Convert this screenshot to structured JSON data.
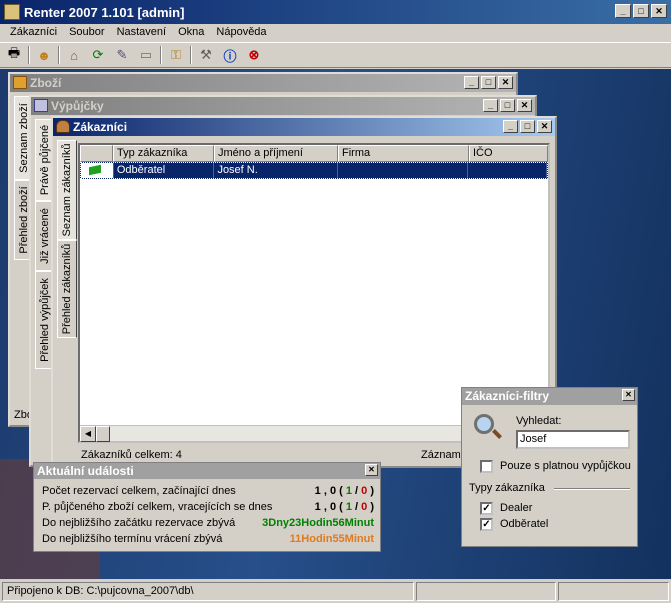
{
  "app": {
    "title": "Renter 2007 1.101 [admin]"
  },
  "menu": {
    "items": [
      "Zákazníci",
      "Soubor",
      "Nastavení",
      "Okna",
      "Nápověda"
    ]
  },
  "toolbar": {
    "icons": [
      "print-icon",
      "user-icon",
      "home-icon",
      "refresh-icon",
      "tools-icon",
      "window-icon",
      "lock-icon",
      "wrench-icon",
      "info-icon",
      "close-icon"
    ]
  },
  "windows": {
    "zbozi": {
      "title": "Zboží",
      "tabs": [
        "Seznam zboží",
        "Přehled zboží"
      ],
      "cut_label": "Zbo"
    },
    "vypujcky": {
      "title": "Výpůjčky",
      "tabs": [
        "Právě půjčené",
        "Již vrácené",
        "Přehled výpůjček"
      ]
    },
    "zakaznici": {
      "title": "Zákazníci",
      "tabs": [
        "Seznam zákazníků",
        "Přehled zákazníků"
      ],
      "columns": [
        "",
        "Typ zákazníka",
        "Jméno a příjmení",
        "Firma",
        "IČO"
      ],
      "rows": [
        {
          "type": "Odběratel",
          "name": "Josef N.",
          "company": "",
          "ico": ""
        }
      ],
      "footer_count": "Zákazníků celkem: 4",
      "footer_right": "Záznam"
    }
  },
  "events": {
    "title": "Aktuální události",
    "rows": [
      {
        "label": "Počet rezervací celkem, začínající dnes",
        "total": "1",
        "today": "0",
        "green": "1",
        "red": "0"
      },
      {
        "label": "P. půjčeného zboží celkem, vracejících se dnes",
        "total": "1",
        "today": "0",
        "green": "1",
        "red": "0"
      },
      {
        "label": "Do nejbližšího začátku rezervace zbývá",
        "value": "3Dny23Hodin56Minut",
        "color": "#008000"
      },
      {
        "label": "Do nejbližšího termínu vrácení zbývá",
        "value": "11Hodin55Minut",
        "color": "#e07a20"
      }
    ]
  },
  "filters": {
    "title": "Zákazníci-filtry",
    "search_label": "Vyhledat:",
    "search_value": "Josef",
    "only_valid_label": "Pouze s platnou vypůjčkou",
    "only_valid_checked": false,
    "types_label": "Typy zákazníka",
    "types": [
      {
        "label": "Dealer",
        "checked": true
      },
      {
        "label": "Odběratel",
        "checked": true
      }
    ]
  },
  "status": {
    "db": "Připojeno k DB: C:\\pujcovna_2007\\db\\"
  }
}
